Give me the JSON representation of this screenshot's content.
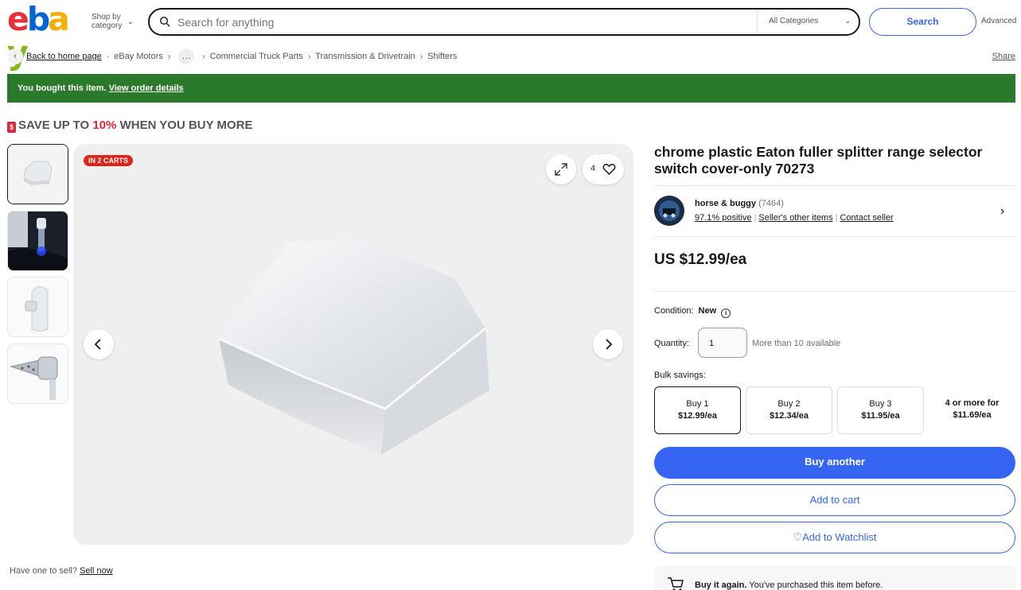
{
  "header": {
    "logo": [
      "e",
      "b",
      "a",
      "y"
    ],
    "logo_colors": [
      "#e53238",
      "#0064d2",
      "#f5af02",
      "#86b817"
    ],
    "shop_by_line1": "Shop by",
    "shop_by_line2": "category",
    "search_placeholder": "Search for anything",
    "category_select": "All Categories",
    "search_button": "Search",
    "advanced": "Advanced"
  },
  "breadcrumb": {
    "back": "Back to home page",
    "items": [
      "eBay Motors",
      "Commercial Truck Parts",
      "Transmission & Drivetrain",
      "Shifters"
    ],
    "more": "…"
  },
  "share": "Share",
  "banner": {
    "text": "You bought this item.",
    "link": "View order details"
  },
  "promo": {
    "pre": "SAVE UP TO ",
    "pct": "10%",
    "post": " WHEN YOU BUY MORE"
  },
  "gallery": {
    "badge": "IN 2 CARTS",
    "watch_count": "4"
  },
  "sell": {
    "text": "Have one to sell?",
    "link": "Sell now"
  },
  "product": {
    "title": "chrome plastic Eaton fuller splitter range selector switch cover-only 70273",
    "price": "US $12.99/ea",
    "condition_label": "Condition:",
    "condition_value": "New",
    "quantity_label": "Quantity:",
    "quantity_value": "1",
    "availability": "More than 10 available",
    "bulk_label": "Bulk savings:",
    "bulk": [
      {
        "qty": "Buy 1",
        "price": "$12.99/ea"
      },
      {
        "qty": "Buy 2",
        "price": "$12.34/ea"
      },
      {
        "qty": "Buy 3",
        "price": "$11.95/ea"
      },
      {
        "qty": "4 or more for",
        "price": "$11.69/ea"
      }
    ],
    "buy_another": "Buy another",
    "add_to_cart": "Add to cart",
    "add_to_watchlist": "Add to Watchlist"
  },
  "seller": {
    "name": "horse & buggy",
    "feedback": "(7464)",
    "positive": "97.1% positive",
    "other_items": "Seller's other items",
    "contact": "Contact seller"
  },
  "buy_again": {
    "bold": "Buy it again.",
    "text": " You've purchased this item before."
  },
  "colors": {
    "accent": "#3665f3",
    "banner": "#2b7a2b",
    "badge": "#e0241a"
  }
}
